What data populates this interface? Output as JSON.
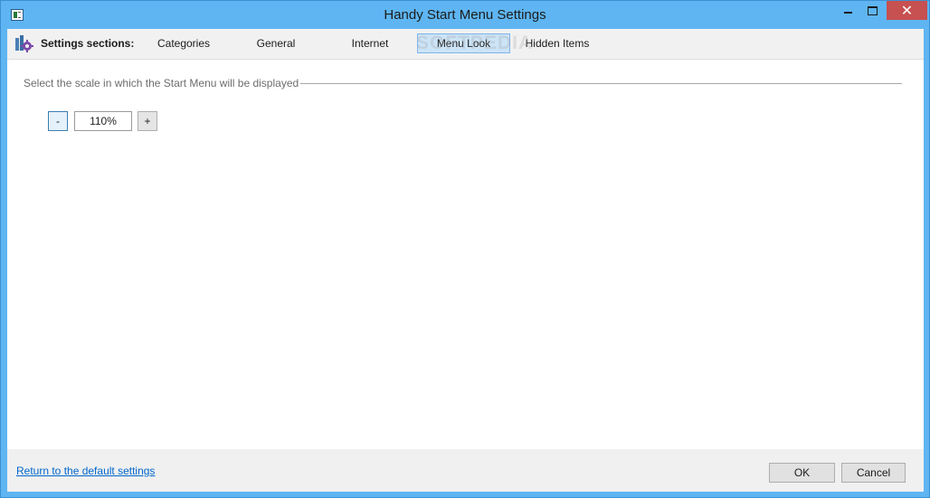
{
  "window": {
    "title": "Handy Start Menu Settings",
    "close_glyph": "✕",
    "icons": {
      "app": "app-icon",
      "minimize": "minimize-icon",
      "maximize": "maximize-icon",
      "close": "close-icon"
    }
  },
  "toolbar": {
    "sections_label": "Settings sections:",
    "sections_icon": "settings-sections-icon",
    "tabs": [
      {
        "label": "Categories",
        "active": false
      },
      {
        "label": "General",
        "active": false
      },
      {
        "label": "Internet",
        "active": false
      },
      {
        "label": "Menu Look",
        "active": true
      },
      {
        "label": "Hidden Items",
        "active": false
      }
    ],
    "watermark": "SOFTPEDIA"
  },
  "scale_group": {
    "label": "Select the scale in which the Start Menu will be displayed",
    "decrement_label": "-",
    "increment_label": "+",
    "value": "110%"
  },
  "footer": {
    "reset_link": "Return to the default settings",
    "ok_label": "OK",
    "cancel_label": "Cancel"
  },
  "colors": {
    "title_bar": "#5eb5f2",
    "close_button": "#c75050",
    "active_tab": "#cce4f7",
    "link": "#0066cc"
  }
}
